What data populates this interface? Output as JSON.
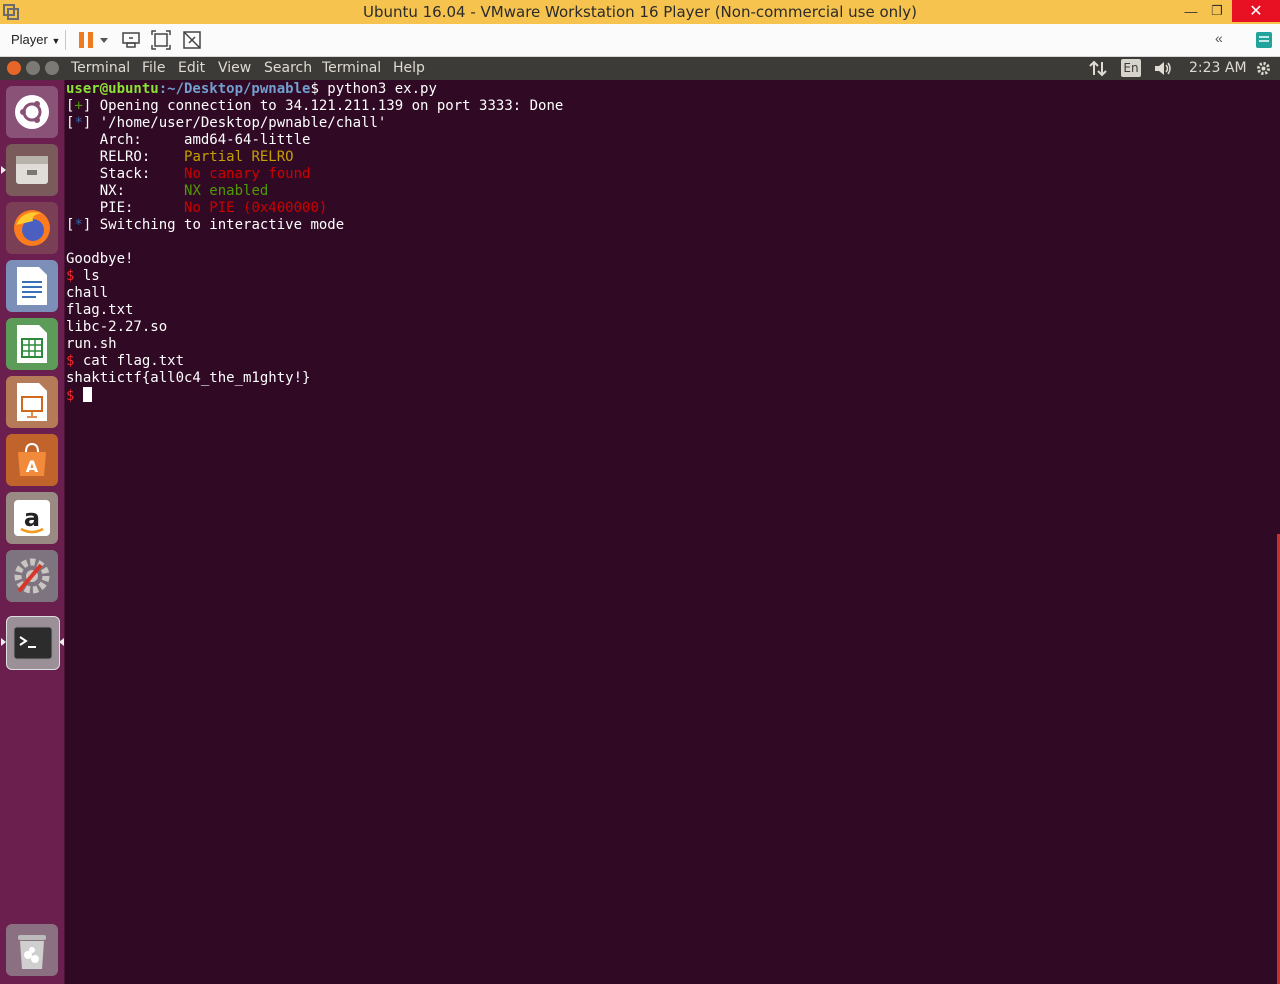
{
  "vm_window": {
    "title": "Ubuntu 16.04 - VMware Workstation 16 Player (Non-commercial use only)",
    "player_menu_label": "Player"
  },
  "ubuntu_panel": {
    "menus": [
      "Terminal",
      "File",
      "Edit",
      "View",
      "Search",
      "Terminal",
      "Help"
    ],
    "keyboard_layout": "En",
    "time": "2:23 AM"
  },
  "launcher": {
    "items": [
      "ubuntu-dash-icon",
      "files-icon",
      "firefox-icon",
      "writer-icon",
      "calc-icon",
      "impress-icon",
      "software-center-icon",
      "amazon-icon",
      "system-settings-icon",
      "terminal-icon",
      "trash-icon"
    ]
  },
  "terminal": {
    "prompt_user": "user@ubuntu",
    "prompt_path": ":~/Desktop/pwnable",
    "command1": " python3 ex.py",
    "open_conn": "Opening connection to 34.121.211.139 on port 3333: Done",
    "binary_path": "'/home/user/Desktop/pwnable/chall'",
    "checksec": {
      "arch_label": "    Arch:     ",
      "arch_value": "amd64-64-little",
      "relro_label": "    RELRO:    ",
      "relro_value": "Partial RELRO",
      "stack_label": "    Stack:    ",
      "stack_value": "No canary found",
      "nx_label": "    NX:       ",
      "nx_value": "NX enabled",
      "pie_label": "    PIE:      ",
      "pie_value": "No PIE (0x400000)"
    },
    "interactive_msg": "Switching to interactive mode",
    "goodbye": "Goodbye!",
    "cmd_ls": " ls",
    "ls_output": [
      "chall",
      "flag.txt",
      "libc-2.27.so",
      "run.sh"
    ],
    "cmd_cat": " cat flag.txt",
    "flag": "shaktictf{all0c4_the_m1ghty!}"
  },
  "colors": {
    "terminal_bg": "#300a24",
    "launcher_bg": "#6a1f4f",
    "vm_titlebar": "#f5c34e",
    "ubuntu_panel": "#3c3b37"
  }
}
